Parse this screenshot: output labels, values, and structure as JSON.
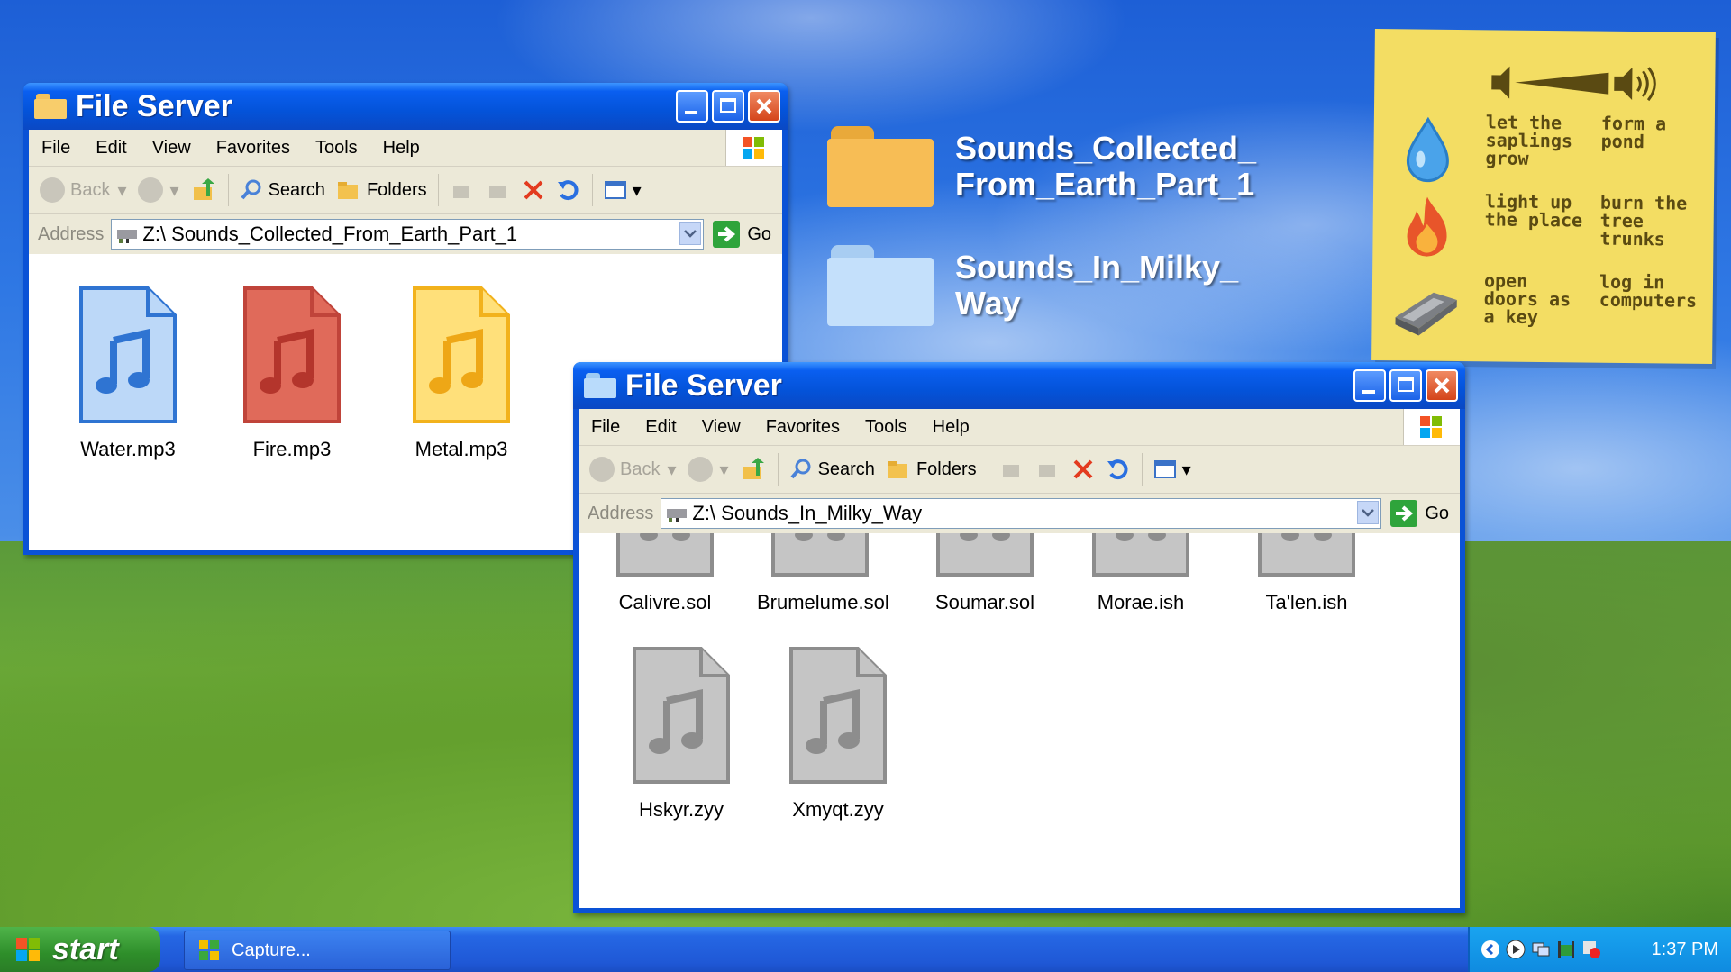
{
  "desktop": {
    "items": [
      {
        "label": "Sounds_Collected_\nFrom_Earth_Part_1",
        "icon": "folder-icon",
        "color": "#f5b94a"
      },
      {
        "label": "Sounds_In_Milky_\nWay",
        "icon": "folder-icon",
        "color": "#b9d8f7"
      }
    ]
  },
  "note": {
    "rows": [
      {
        "icon": "water-drop-icon",
        "col1": "let the\nsaplings\ngrow",
        "col2": "form a\npond"
      },
      {
        "icon": "fire-icon",
        "col1": "light up\nthe place",
        "col2": "burn the\ntree\ntrunks"
      },
      {
        "icon": "metal-bar-icon",
        "col1": "open\ndoors as\na key",
        "col2": "log in\ncomputers"
      }
    ]
  },
  "window1": {
    "title": "File Server",
    "menu": [
      "File",
      "Edit",
      "View",
      "Favorites",
      "Tools",
      "Help"
    ],
    "toolbar": {
      "back": "Back",
      "search": "Search",
      "folders": "Folders"
    },
    "address_label": "Address",
    "address": "Z:\\ Sounds_Collected_From_Earth_Part_1",
    "go": "Go",
    "files": [
      {
        "name": "Water.mp3",
        "color": "#bcd8f8",
        "stroke": "#2f74d2",
        "note": "#2f74d2"
      },
      {
        "name": "Fire.mp3",
        "color": "#e06a5a",
        "stroke": "#c0443a",
        "note": "#b4352c"
      },
      {
        "name": "Metal.mp3",
        "color": "#ffe07a",
        "stroke": "#f2b21c",
        "note": "#eea716"
      }
    ]
  },
  "window2": {
    "title": "File Server",
    "menu": [
      "File",
      "Edit",
      "View",
      "Favorites",
      "Tools",
      "Help"
    ],
    "toolbar": {
      "back": "Back",
      "search": "Search",
      "folders": "Folders"
    },
    "address_label": "Address",
    "address": "Z:\\ Sounds_In_Milky_Way",
    "go": "Go",
    "files_row1": [
      "Calivre.sol",
      "Brumelume.sol",
      "Soumar.sol",
      "Morae.ish",
      "Ta'len.ish"
    ],
    "files_row2": [
      "Hskyr.zyy",
      "Xmyqt.zyy"
    ]
  },
  "taskbar": {
    "start": "start",
    "task": "Capture...",
    "clock": "1:37 PM"
  }
}
